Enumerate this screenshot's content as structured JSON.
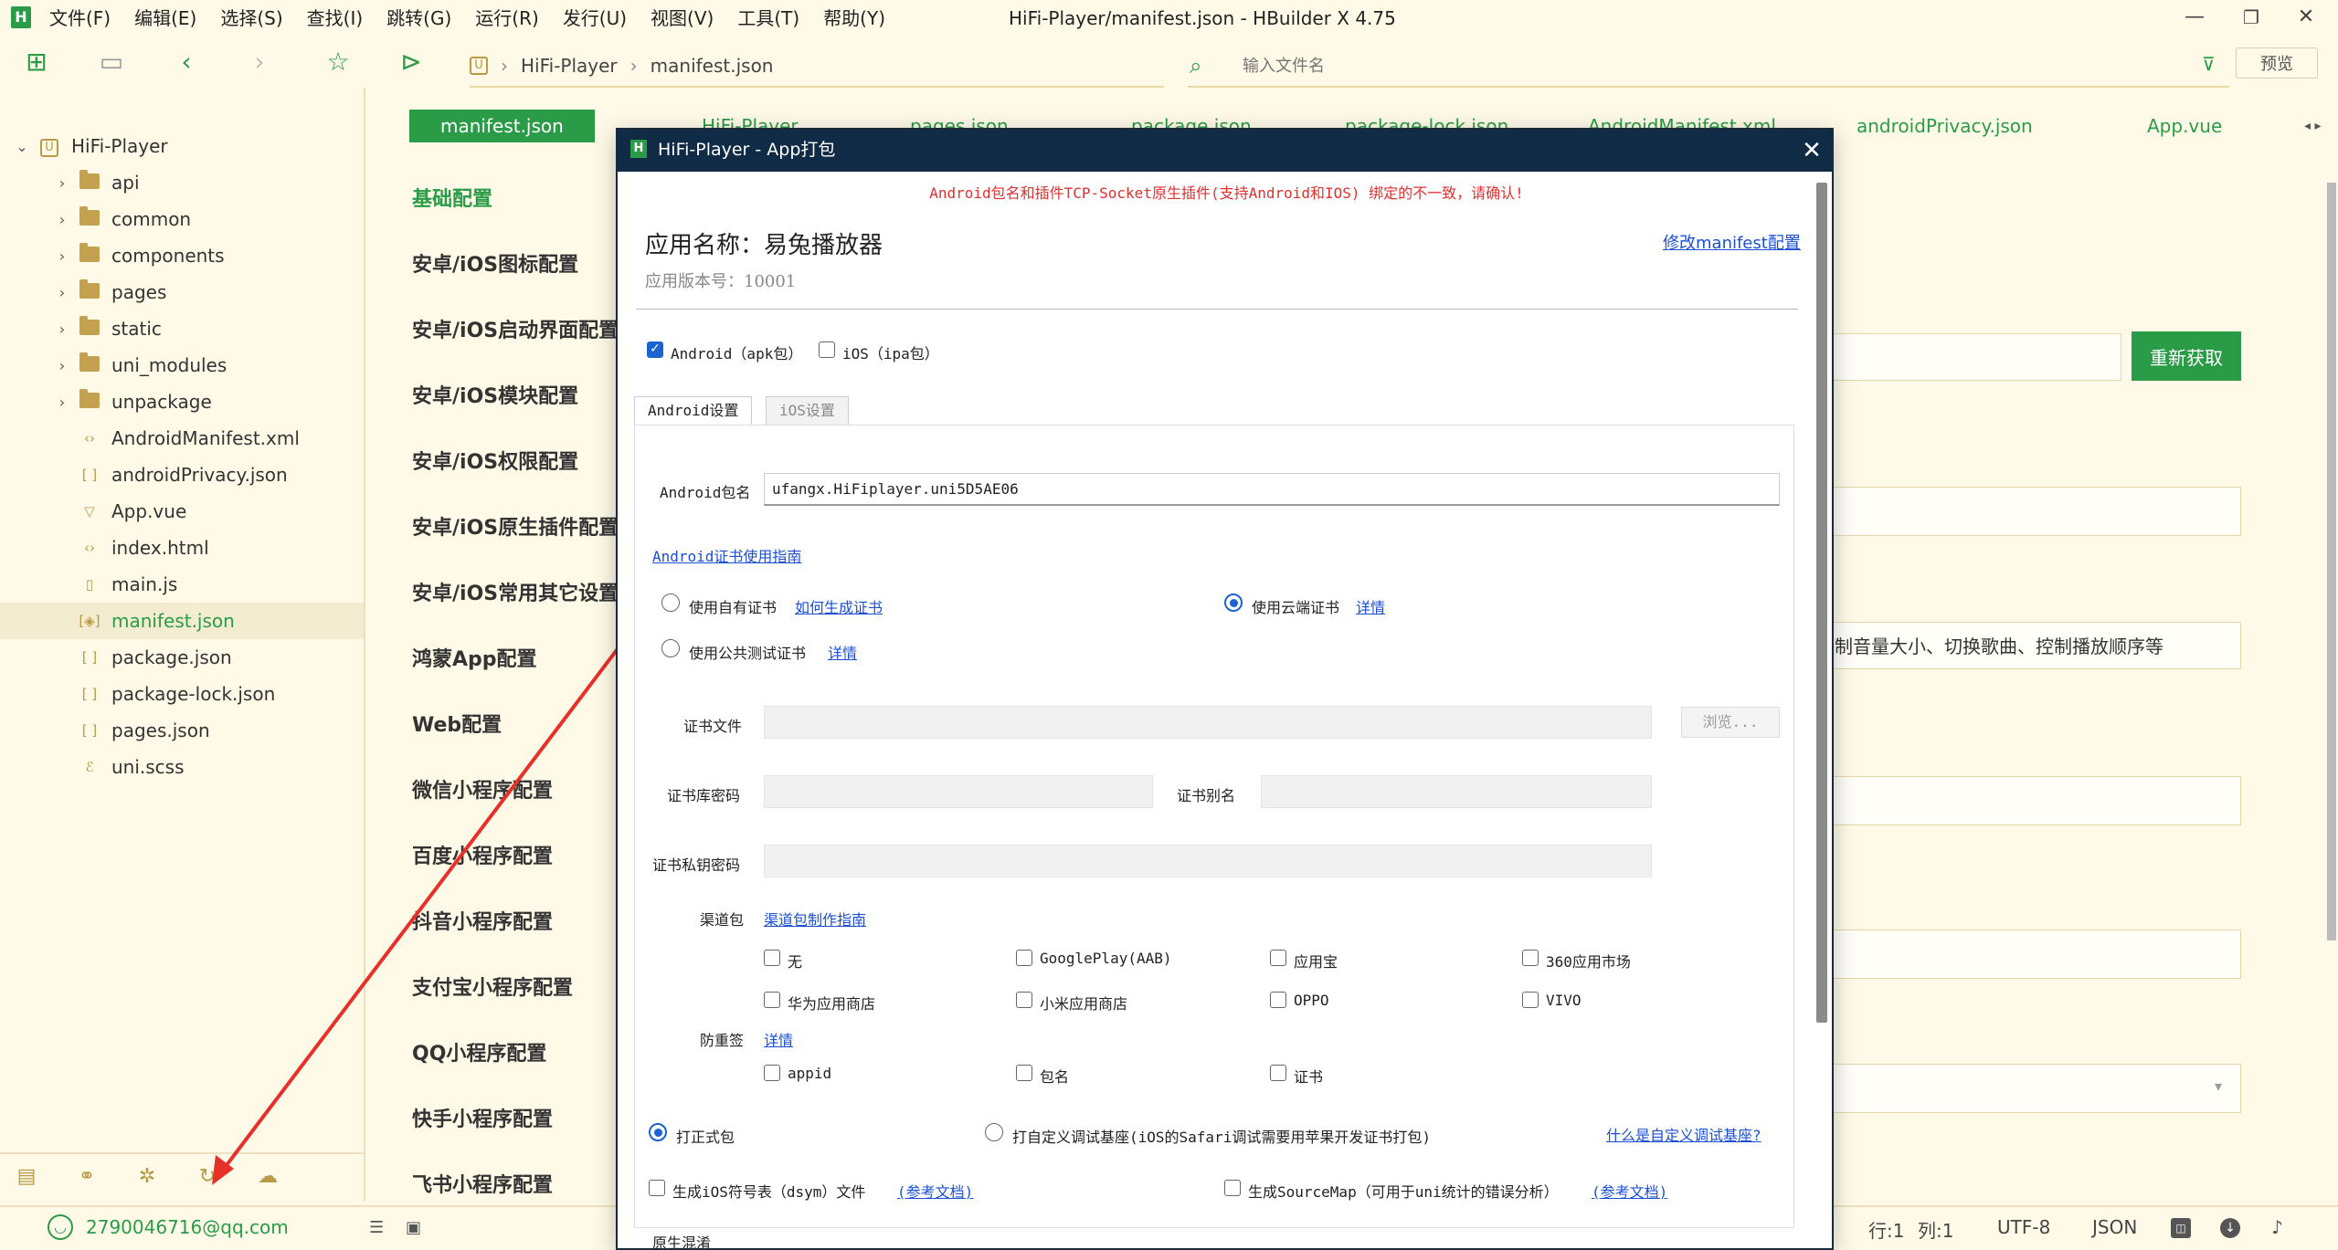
{
  "menu": {
    "items": [
      "文件(F)",
      "编辑(E)",
      "选择(S)",
      "查找(I)",
      "跳转(G)",
      "运行(R)",
      "发行(U)",
      "视图(V)",
      "工具(T)",
      "帮助(Y)"
    ],
    "window_title": "HiFi-Player/manifest.json - HBuilder X 4.75"
  },
  "toolbar": {
    "breadcrumb": [
      "HiFi-Player",
      "manifest.json"
    ],
    "file_search_placeholder": "输入文件名",
    "preview_label": "预览"
  },
  "sidebar": {
    "project": "HiFi-Player",
    "items": [
      {
        "label": "api",
        "kind": "folder"
      },
      {
        "label": "common",
        "kind": "folder"
      },
      {
        "label": "components",
        "kind": "folder"
      },
      {
        "label": "pages",
        "kind": "folder"
      },
      {
        "label": "static",
        "kind": "folder"
      },
      {
        "label": "uni_modules",
        "kind": "folder"
      },
      {
        "label": "unpackage",
        "kind": "folder"
      },
      {
        "label": "AndroidManifest.xml",
        "kind": "xml"
      },
      {
        "label": "androidPrivacy.json",
        "kind": "json"
      },
      {
        "label": "App.vue",
        "kind": "vue"
      },
      {
        "label": "index.html",
        "kind": "html"
      },
      {
        "label": "main.js",
        "kind": "js"
      },
      {
        "label": "manifest.json",
        "kind": "manifest"
      },
      {
        "label": "package.json",
        "kind": "json"
      },
      {
        "label": "package-lock.json",
        "kind": "json"
      },
      {
        "label": "pages.json",
        "kind": "json"
      },
      {
        "label": "uni.scss",
        "kind": "scss"
      }
    ]
  },
  "editor_tabs": [
    "manifest.json",
    "HiFi-Player",
    "pages.json",
    "package.json",
    "package-lock.json",
    "AndroidManifest.xml",
    "androidPrivacy.json",
    "App.vue"
  ],
  "config_nav": [
    "基础配置",
    "安卓/iOS图标配置",
    "安卓/iOS启动界面配置",
    "安卓/iOS模块配置",
    "安卓/iOS权限配置",
    "安卓/iOS原生插件配置",
    "安卓/iOS常用其它设置",
    "鸿蒙App配置",
    "Web配置",
    "微信小程序配置",
    "百度小程序配置",
    "抖音小程序配置",
    "支付宝小程序配置",
    "QQ小程序配置",
    "快手小程序配置",
    "飞书小程序配置"
  ],
  "background_form": {
    "refresh_label": "重新获取",
    "description_text": "制音量大小、切换歌曲、控制播放顺序等"
  },
  "status": {
    "account": "2790046716@qq.com",
    "line": "行:1",
    "col": "列:1",
    "encoding": "UTF-8",
    "language": "JSON"
  },
  "dialog": {
    "title": "HiFi-Player - App打包",
    "warning": "Android包名和插件TCP-Socket原生插件(支持Android和IOS) 绑定的不一致，请确认!",
    "app_name": "应用名称：易兔播放器",
    "app_version": "应用版本号：10001",
    "edit_manifest_link": "修改manifest配置",
    "platform_android": "Android（apk包）",
    "platform_ios": "iOS（ipa包）",
    "tab_android": "Android设置",
    "tab_ios": "iOS设置",
    "package_label": "Android包名",
    "package_value": "ufangx.HiFiplayer.uni5D5AE06",
    "cert_guide_link": "Android证书使用指南",
    "cert_own": "使用自有证书",
    "cert_own_link": "如何生成证书",
    "cert_cloud": "使用云端证书",
    "cert_cloud_link": "详情",
    "cert_public": "使用公共测试证书",
    "cert_public_link": "详情",
    "cert_file_label": "证书文件",
    "browse_label": "浏览...",
    "keystore_pwd_label": "证书库密码",
    "alias_label": "证书别名",
    "key_pwd_label": "证书私钥密码",
    "channel_label": "渠道包",
    "channel_guide_link": "渠道包制作指南",
    "channels": [
      "无",
      "GooglePlay(AAB)",
      "应用宝",
      "360应用市场",
      "华为应用商店",
      "小米应用商店",
      "OPPO",
      "VIVO"
    ],
    "anti_label": "防重签",
    "anti_link": "详情",
    "anti_options": [
      "appid",
      "包名",
      "证书"
    ],
    "build_formal": "打正式包",
    "build_custom": "打自定义调试基座(iOS的Safari调试需要用苹果开发证书打包)",
    "custom_base_link": "什么是自定义调试基座?",
    "dsym_label": "生成iOS符号表（dsym）文件",
    "dsym_link": "(参考文档)",
    "sourcemap_label": "生成SourceMap（可用于uni统计的错误分析）",
    "sourcemap_link": "(参考文档)",
    "native_label": "原生混淆"
  }
}
